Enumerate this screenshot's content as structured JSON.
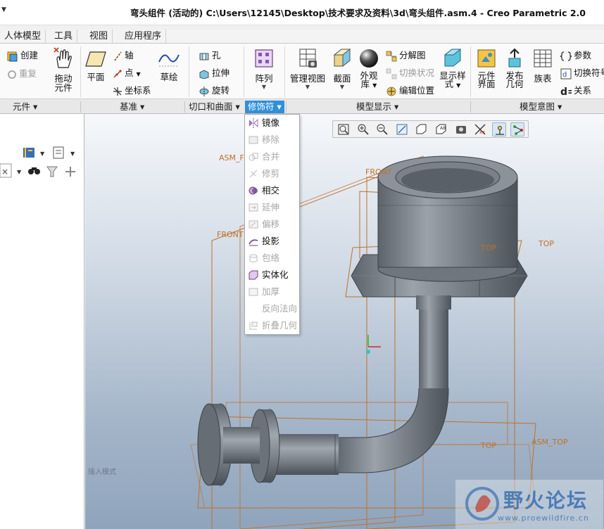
{
  "window": {
    "title": "弯头组件 (活动的) C:\\Users\\12145\\Desktop\\技术要求及资料\\3d\\弯头组件.asm.4 - Creo Parametric 2.0"
  },
  "menu_tabs": [
    "人体模型",
    "工具",
    "视图",
    "应用程序"
  ],
  "ribbon": {
    "create": "创建",
    "redo": "重复",
    "drag_component": [
      "拖动",
      "元件"
    ],
    "plane": "平面",
    "axis": "轴",
    "point": "点",
    "csys": "坐标系",
    "sketch": "草绘",
    "hole": "孔",
    "extrude": "拉伸",
    "revolve": "旋转",
    "pattern": "阵列",
    "manage_views": "管理视图",
    "section": "截面",
    "appearance": [
      "外观",
      "库"
    ],
    "exploded_view": "分解图",
    "toggle_status": "切换状况",
    "edit_position": "编辑位置",
    "display_style": [
      "显示样",
      "式"
    ],
    "component_interface": [
      "元件",
      "界面"
    ],
    "publish_geometry": [
      "发布",
      "几何"
    ],
    "family_table": "族表",
    "parameters": "参数",
    "switch_symbols": "切换符号",
    "relations": "关系"
  },
  "groups": {
    "component": "元件",
    "datum": "基准",
    "cut_surface": "切口和曲面",
    "modifiers": "修饰符",
    "model_display": "模型显示",
    "model_intent": "模型意图"
  },
  "dropdown_items": [
    {
      "label": "镜像",
      "enabled": true,
      "icon": "mirror-icon"
    },
    {
      "label": "移除",
      "enabled": false,
      "icon": "remove-icon"
    },
    {
      "label": "合并",
      "enabled": false,
      "icon": "merge-icon"
    },
    {
      "label": "修剪",
      "enabled": false,
      "icon": "trim-icon"
    },
    {
      "label": "相交",
      "enabled": true,
      "icon": "intersect-icon"
    },
    {
      "label": "延伸",
      "enabled": false,
      "icon": "extend-icon"
    },
    {
      "label": "偏移",
      "enabled": false,
      "icon": "offset-icon"
    },
    {
      "label": "投影",
      "enabled": true,
      "icon": "project-icon"
    },
    {
      "label": "包络",
      "enabled": false,
      "icon": "wrap-icon"
    },
    {
      "label": "实体化",
      "enabled": true,
      "icon": "solidify-icon"
    },
    {
      "label": "加厚",
      "enabled": false,
      "icon": "thicken-icon"
    },
    {
      "label": "反向法向",
      "enabled": false,
      "icon": ""
    },
    {
      "label": "折叠几何",
      "enabled": false,
      "icon": "fold-geometry-icon"
    }
  ],
  "datum_labels": {
    "asm_front": "ASM_FRONT",
    "front_top": "FRONT",
    "front_left": "FRONT",
    "top_right": "TOP",
    "top_inner": "TOP",
    "top_bottom": "TOP",
    "asm_top": "ASM_TOP"
  },
  "status": {
    "mode": "插入模式"
  },
  "watermark": {
    "name": "野火论坛",
    "url": "www.proewildfire.cn"
  },
  "colors": {
    "accent": "#2f8fd8",
    "datum": "#c0712a",
    "model": "#7d848c"
  }
}
